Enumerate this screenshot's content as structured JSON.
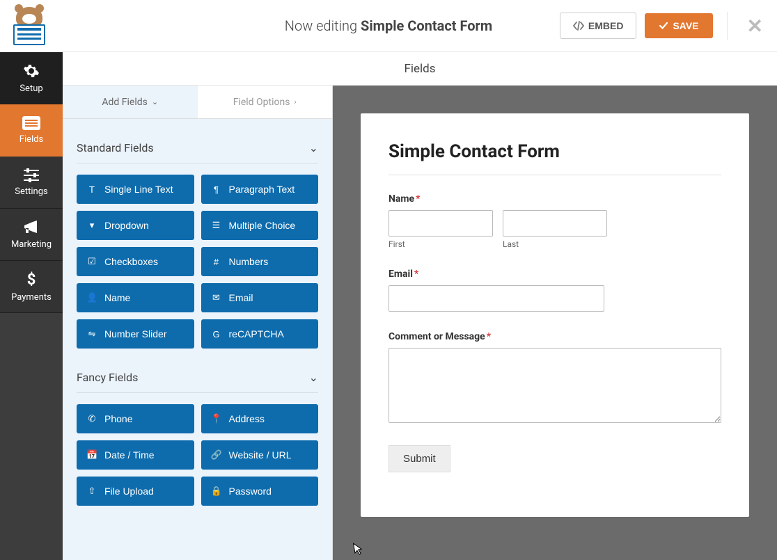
{
  "header": {
    "editing_prefix": "Now editing ",
    "form_name": "Simple Contact Form",
    "embed_label": "EMBED",
    "save_label": "SAVE"
  },
  "leftnav": {
    "setup": "Setup",
    "fields": "Fields",
    "settings": "Settings",
    "marketing": "Marketing",
    "payments": "Payments"
  },
  "fields_header": "Fields",
  "panel_tabs": {
    "add_fields": "Add Fields",
    "field_options": "Field Options"
  },
  "sections": {
    "standard": {
      "title": "Standard Fields",
      "items": [
        {
          "icon": "single-line",
          "label": "Single Line Text"
        },
        {
          "icon": "paragraph",
          "label": "Paragraph Text"
        },
        {
          "icon": "dropdown",
          "label": "Dropdown"
        },
        {
          "icon": "multiple",
          "label": "Multiple Choice"
        },
        {
          "icon": "checkboxes",
          "label": "Checkboxes"
        },
        {
          "icon": "numbers",
          "label": "Numbers"
        },
        {
          "icon": "name",
          "label": "Name"
        },
        {
          "icon": "email",
          "label": "Email"
        },
        {
          "icon": "slider",
          "label": "Number Slider"
        },
        {
          "icon": "recaptcha",
          "label": "reCAPTCHA"
        }
      ]
    },
    "fancy": {
      "title": "Fancy Fields",
      "items": [
        {
          "icon": "phone",
          "label": "Phone"
        },
        {
          "icon": "address",
          "label": "Address"
        },
        {
          "icon": "date",
          "label": "Date / Time"
        },
        {
          "icon": "url",
          "label": "Website / URL"
        },
        {
          "icon": "upload",
          "label": "File Upload"
        },
        {
          "icon": "password",
          "label": "Password"
        }
      ]
    }
  },
  "form": {
    "title": "Simple Contact Form",
    "name_label": "Name",
    "first_sublabel": "First",
    "last_sublabel": "Last",
    "email_label": "Email",
    "comment_label": "Comment or Message",
    "submit_label": "Submit",
    "required_marker": "*"
  },
  "icon_glyphs": {
    "single-line": "T",
    "paragraph": "¶",
    "dropdown": "▾",
    "multiple": "☰",
    "checkboxes": "☑",
    "numbers": "#",
    "name": "👤",
    "email": "✉",
    "slider": "⇋",
    "recaptcha": "G",
    "phone": "✆",
    "address": "📍",
    "date": "📅",
    "url": "🔗",
    "upload": "⇧",
    "password": "🔒"
  }
}
